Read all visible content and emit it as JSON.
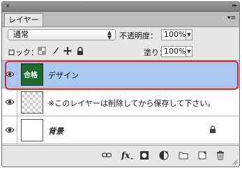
{
  "panel": {
    "tab_label": "レイヤー",
    "close_glyph": "×",
    "collapse_glyph": "▸▸",
    "menu_glyph": "▾≡"
  },
  "controls": {
    "blend_mode": "通常",
    "opacity_label": "不透明度：",
    "opacity_value": "100%",
    "lock_label": "ロック：",
    "fill_label": "塗り：",
    "fill_value": "100%"
  },
  "layers": [
    {
      "name": "デザイン",
      "selected": true,
      "visible": true
    },
    {
      "name": "※このレイヤーは削除してから保存して下さい。",
      "selected": false,
      "visible": true
    },
    {
      "name": "背景",
      "selected": false,
      "visible": true,
      "locked": true
    }
  ],
  "thumbnail": {
    "text": "合格"
  },
  "bottom_icons": [
    "link-icon",
    "fx-icon",
    "mask-icon",
    "adjustment-icon",
    "folder-icon",
    "new-layer-icon",
    "trash-icon"
  ],
  "colors": {
    "selection": "#a8c8f0",
    "highlight": "#e3232a",
    "thumb_green": "#1f6b2e"
  }
}
